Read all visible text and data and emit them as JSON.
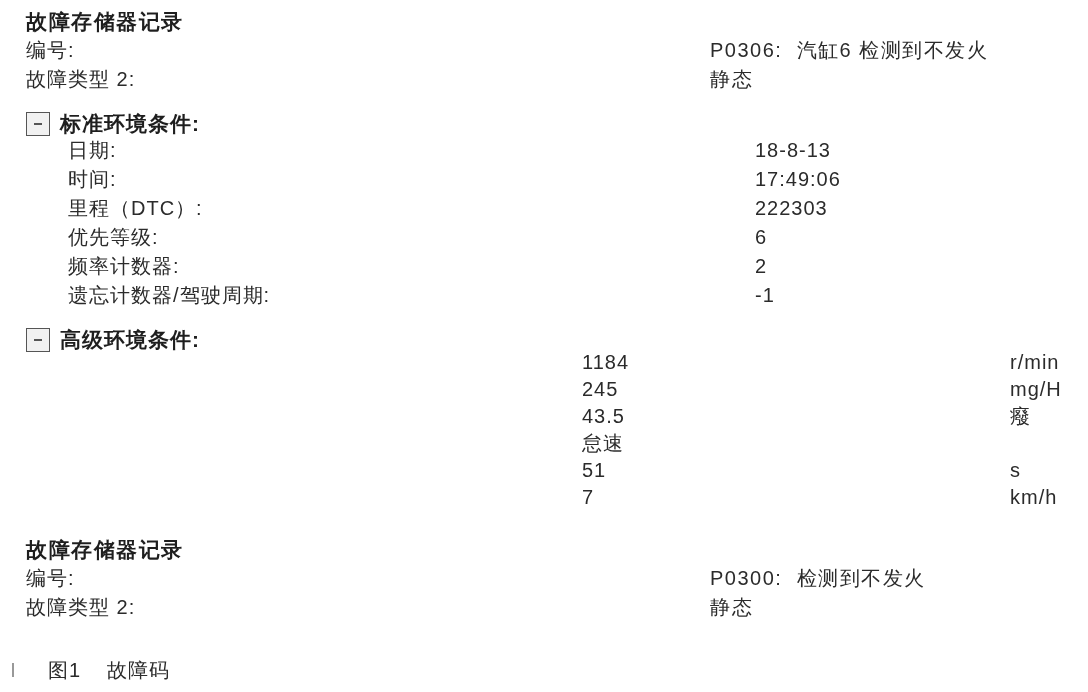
{
  "records": [
    {
      "title": "故障存储器记录",
      "fields": [
        {
          "label": "编号:",
          "value": "P0306:  汽缸6 检测到不发火"
        },
        {
          "label": "故障类型 2:",
          "value": "静态"
        }
      ],
      "sections": [
        {
          "title": "标准环境条件:",
          "expanded": true,
          "kind": "labeled",
          "rows": [
            {
              "label": "日期:",
              "value": "18-8-13"
            },
            {
              "label": "时间:",
              "value": "17:49:06"
            },
            {
              "label": "里程（DTC）:",
              "value": "222303"
            },
            {
              "label": "优先等级:",
              "value": "6"
            },
            {
              "label": "频率计数器:",
              "value": "2"
            },
            {
              "label": "遗忘计数器/驾驶周期:",
              "value": "-1"
            }
          ]
        },
        {
          "title": "高级环境条件:",
          "expanded": true,
          "kind": "measured",
          "rows": [
            {
              "value": "1184",
              "unit": "r/min"
            },
            {
              "value": "245",
              "unit": "mg/H"
            },
            {
              "value": "43.5",
              "unit": "癈"
            },
            {
              "value": "怠速"
            },
            {
              "value": "51",
              "unit": "s"
            },
            {
              "value": "7",
              "unit": "km/h"
            }
          ]
        }
      ]
    },
    {
      "title": "故障存储器记录",
      "fields": [
        {
          "label": "编号:",
          "value": "P0300:  检测到不发火"
        },
        {
          "label": "故障类型 2:",
          "value": "静态"
        }
      ]
    }
  ],
  "caption": {
    "number": "图1",
    "text": "故障码"
  }
}
